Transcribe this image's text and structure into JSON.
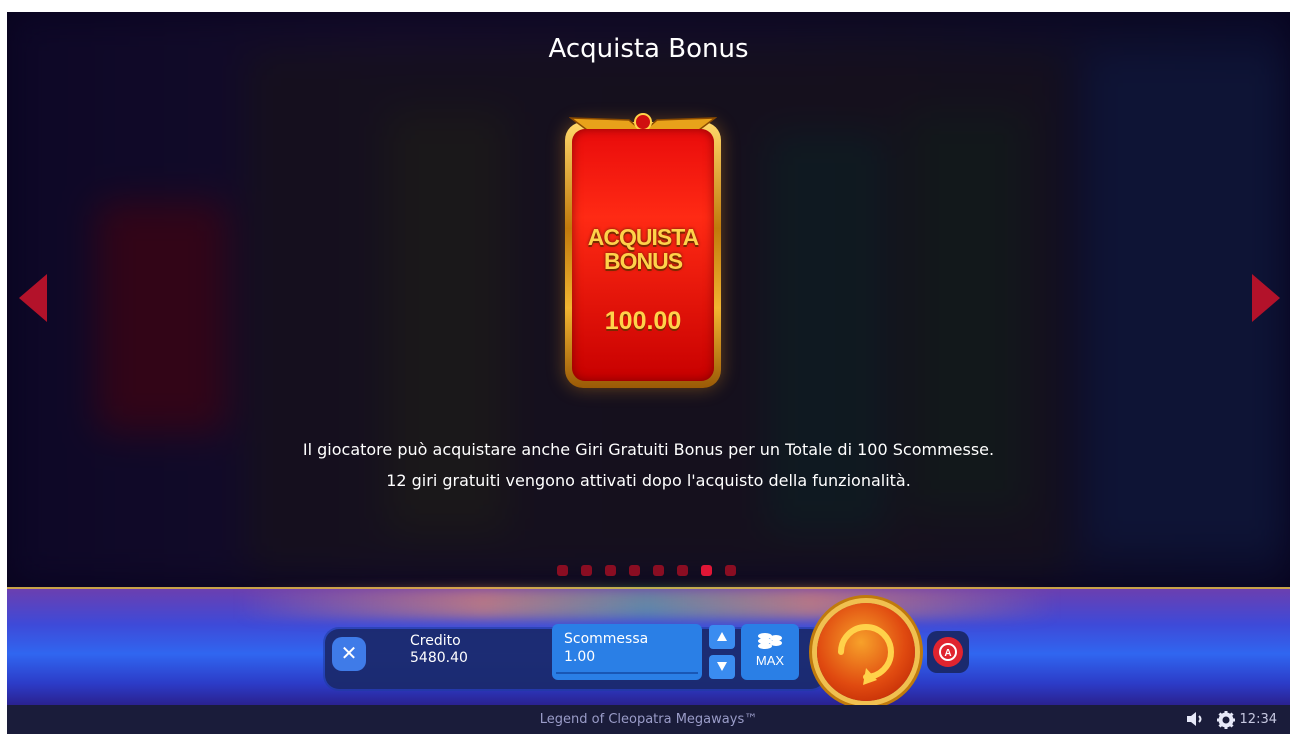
{
  "dialog": {
    "title": "Acquista Bonus",
    "card_label_line1": "ACQUISTA",
    "card_label_line2": "BONUS",
    "card_price": "100.00",
    "description_line1": "Il giocatore può acquistare anche Giri Gratuiti Bonus per un Totale di 100 Scommesse.",
    "description_line2": "12 giri gratuiti vengono attivati dopo l'acquisto della funzionalità.",
    "pagination": {
      "total": 8,
      "active_index": 6
    }
  },
  "controls": {
    "credit_label": "Credito",
    "credit_value": "5480.40",
    "bet_label": "Scommessa",
    "bet_value": "1.00",
    "max_label": "MAX"
  },
  "status": {
    "game_name": "Legend of Cleopatra Megaways™",
    "time": "12:34"
  },
  "colors": {
    "accent_red": "#b3122a",
    "button_blue": "#2a7fe6",
    "spin_orange": "#e04a10",
    "gold": "#f0c050"
  },
  "icons": [
    "arrow-left-icon",
    "arrow-right-icon",
    "close-icon",
    "arrow-up-icon",
    "arrow-down-icon",
    "coins-icon",
    "spin-icon",
    "autoplay-icon",
    "sound-icon",
    "gear-icon"
  ]
}
